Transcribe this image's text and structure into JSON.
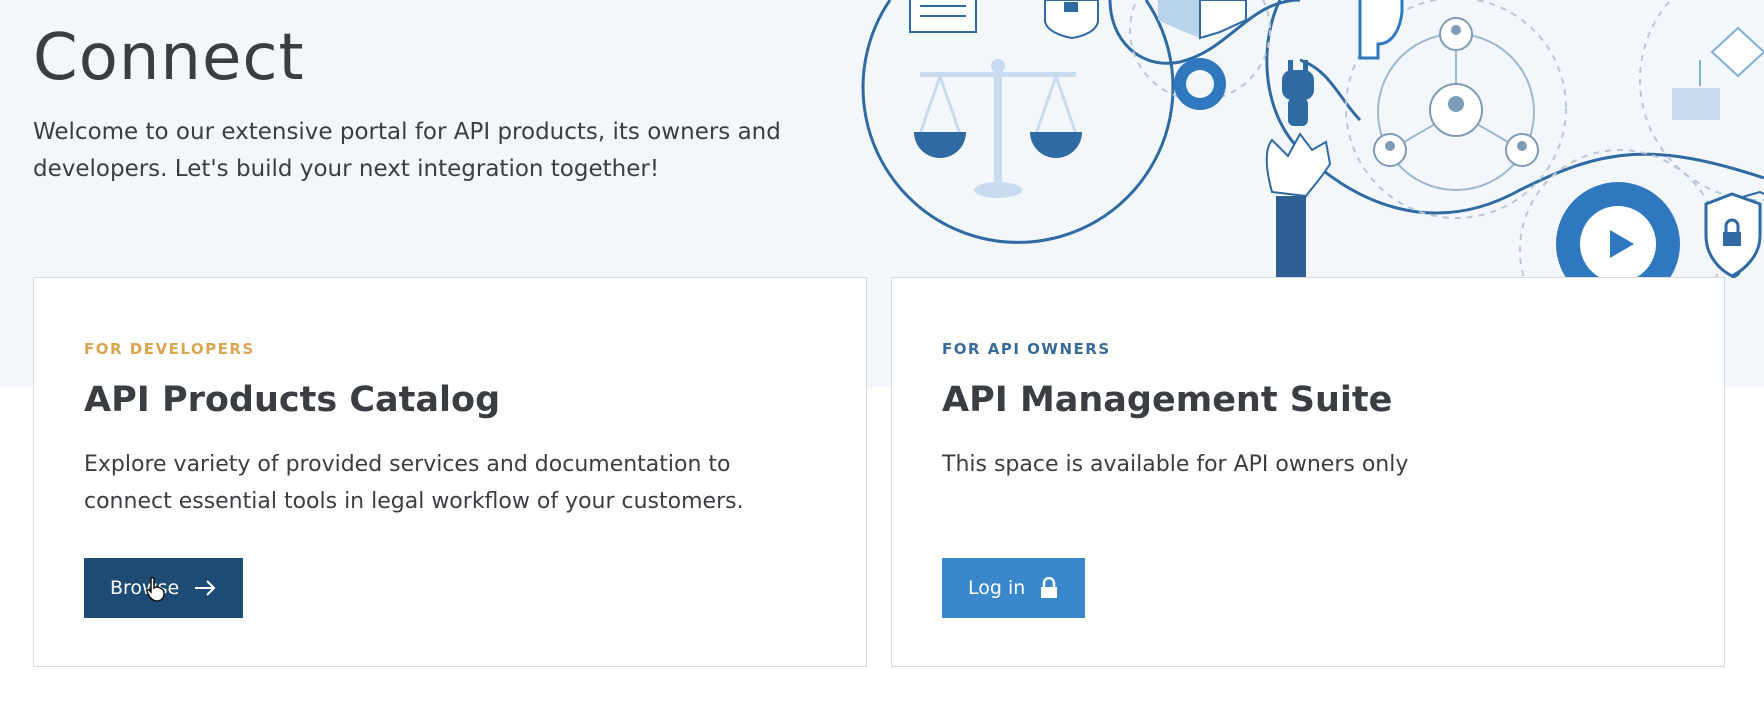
{
  "hero": {
    "title": "Connect",
    "intro": "Welcome to our extensive portal for API products, its owners and developers. Let's build your next integration together!"
  },
  "cards": {
    "developers": {
      "eyebrow": "FOR DEVELOPERS",
      "title": "API Products Catalog",
      "text": "Explore variety of provided services and documentation to connect essential tools in legal workflow of your customers.",
      "button": "Browse",
      "button_icon": "arrow-right-icon"
    },
    "owners": {
      "eyebrow": "FOR API OWNERS",
      "title": "API Management Suite",
      "text": "This space is available for API owners only",
      "button": "Log in",
      "button_icon": "lock-icon"
    }
  },
  "colors": {
    "hero_background": "#f3f7fb",
    "developers_eyebrow": "#d9a550",
    "owners_eyebrow": "#3a6a96",
    "browse_button": "#1e4a76",
    "login_button": "#3a87cb"
  }
}
